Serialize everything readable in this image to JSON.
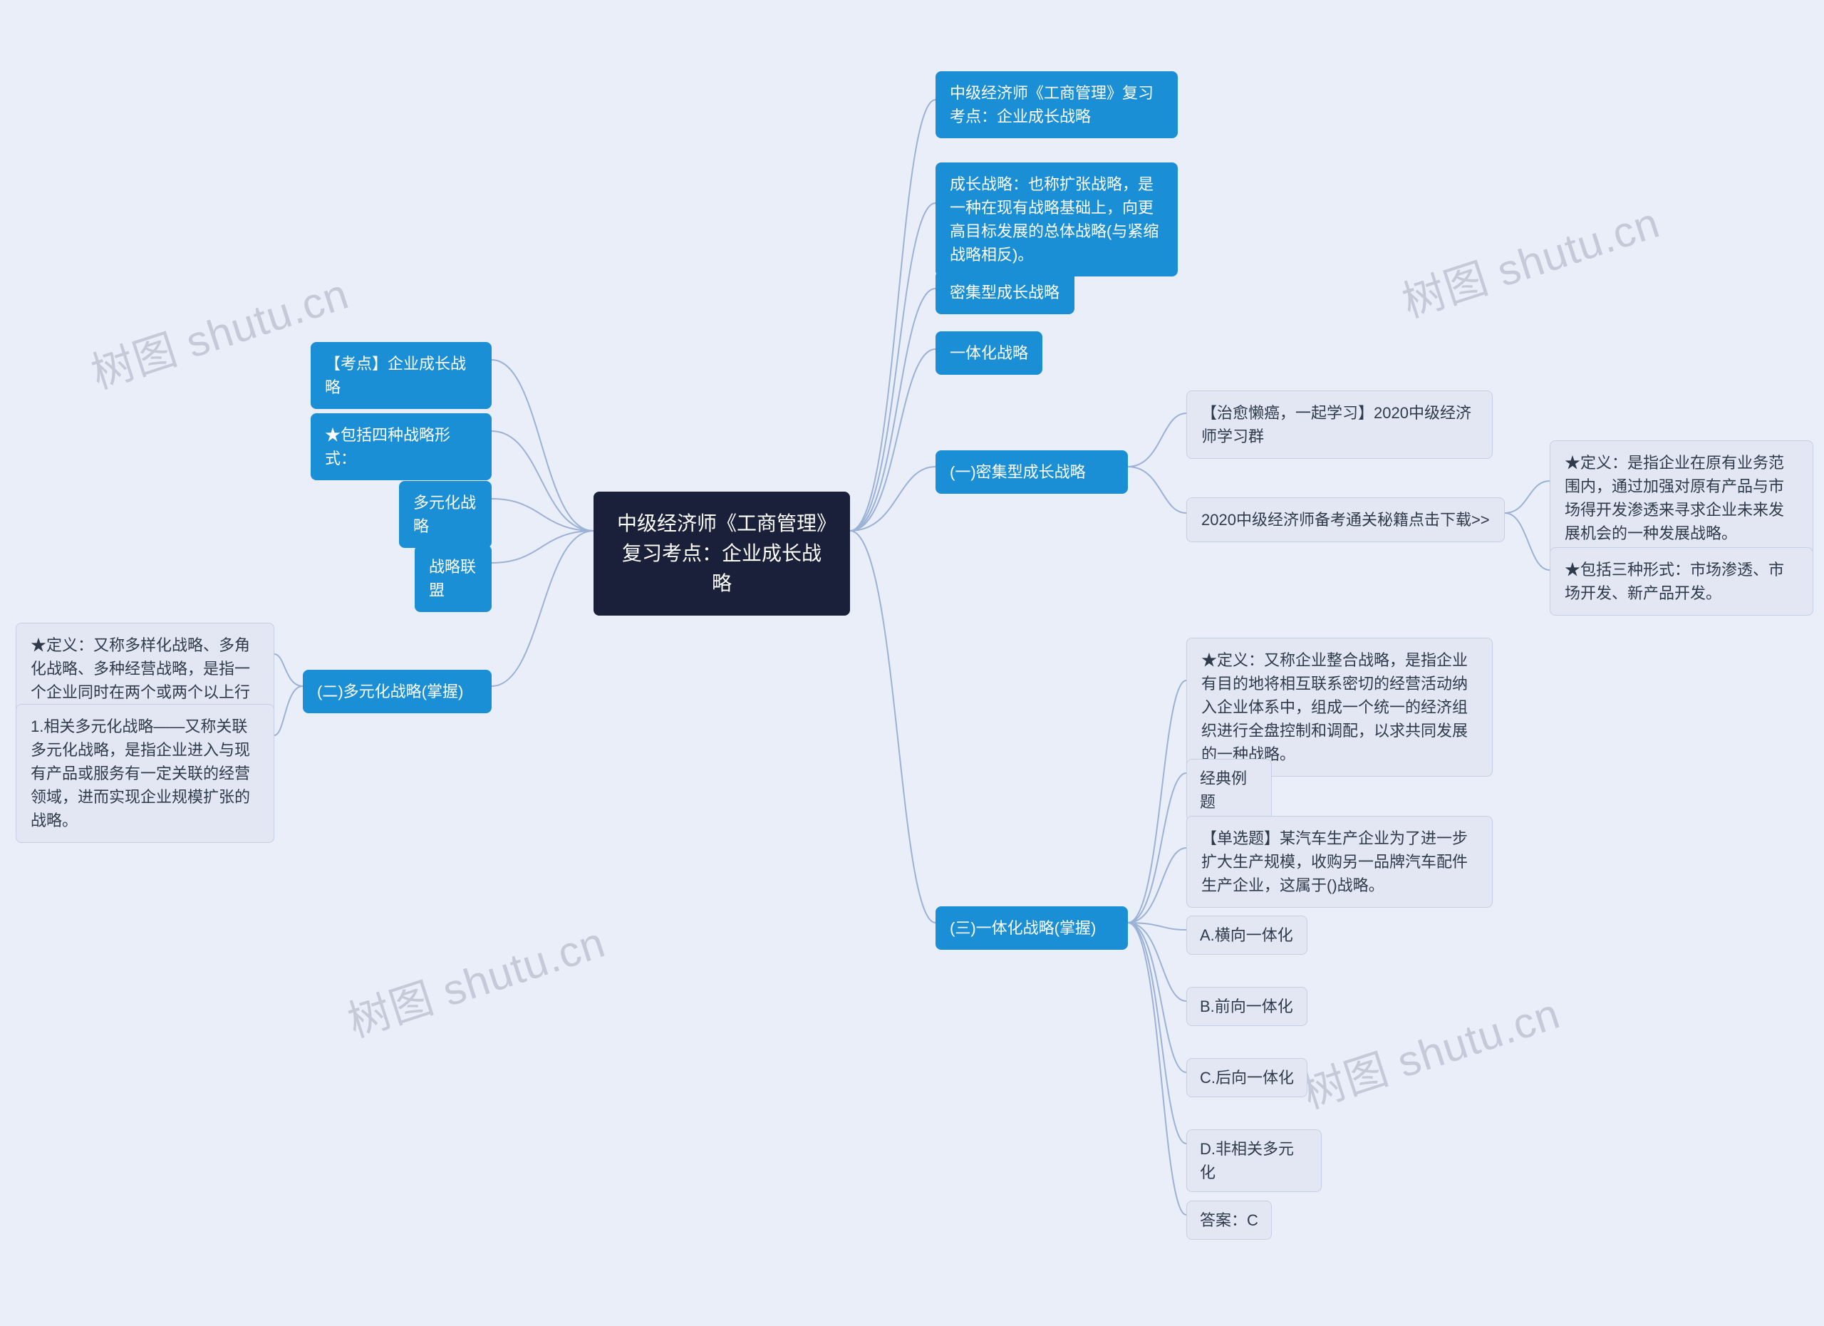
{
  "root": "中级经济师《工商管理》复习考点：企业成长战略",
  "watermark": "树图 shutu.cn",
  "left": {
    "l0": "【考点】企业成长战略",
    "l1": "★包括四种战略形式：",
    "l2": "多元化战略",
    "l3": "战略联盟",
    "l4": "(二)多元化战略(掌握)",
    "l4c0": "★定义：又称多样化战略、多角化战略、多种经营战略，是指一个企业同时在两个或两个以上行业中进行经营。",
    "l4c1": "1.相关多元化战略——又称关联多元化战略，是指企业进入与现有产品或服务有一定关联的经营领域，进而实现企业规模扩张的战略。"
  },
  "right": {
    "r0": "中级经济师《工商管理》复习考点：企业成长战略",
    "r1": "成长战略：也称扩张战略，是一种在现有战略基础上，向更高目标发展的总体战略(与紧缩战略相反)。",
    "r2": "密集型成长战略",
    "r3": "一体化战略",
    "r4": "(一)密集型成长战略",
    "r4c0": "【治愈懒癌，一起学习】2020中级经济师学习群",
    "r4c1": "2020中级经济师备考通关秘籍点击下载>>",
    "r4c1a": "★定义：是指企业在原有业务范围内，通过加强对原有产品与市场得开发渗透来寻求企业未来发展机会的一种发展战略。",
    "r4c1b": "★包括三种形式：市场渗透、市场开发、新产品开发。",
    "r5": "(三)一体化战略(掌握)",
    "r5c0": "★定义：又称企业整合战略，是指企业有目的地将相互联系密切的经营活动纳入企业体系中，组成一个统一的经济组织进行全盘控制和调配，以求共同发展的一种战略。",
    "r5c1": "经典例题",
    "r5c2": "【单选题】某汽车生产企业为了进一步扩大生产规模，收购另一品牌汽车配件生产企业，这属于()战略。",
    "r5c3": "A.横向一体化",
    "r5c4": "B.前向一体化",
    "r5c5": "C.后向一体化",
    "r5c6": "D.非相关多元化",
    "r5c7": "答案：C"
  }
}
